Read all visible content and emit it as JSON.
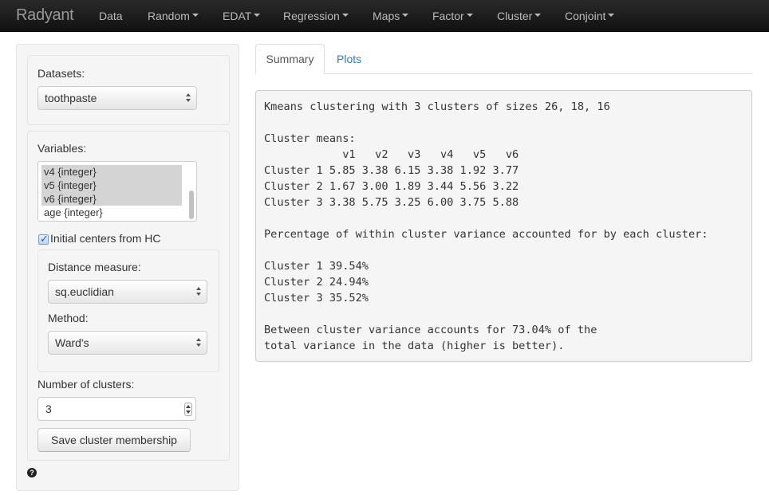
{
  "navbar": {
    "brand": "Radyant",
    "items": [
      {
        "label": "Data",
        "dropdown": false
      },
      {
        "label": "Random",
        "dropdown": true
      },
      {
        "label": "EDAT",
        "dropdown": true
      },
      {
        "label": "Regression",
        "dropdown": true
      },
      {
        "label": "Maps",
        "dropdown": true
      },
      {
        "label": "Factor",
        "dropdown": true
      },
      {
        "label": "Cluster",
        "dropdown": true
      },
      {
        "label": "Conjoint",
        "dropdown": true
      }
    ]
  },
  "sidebar": {
    "datasets_label": "Datasets:",
    "dataset_value": "toothpaste",
    "variables_label": "Variables:",
    "variables": [
      {
        "label": "v4 {integer}",
        "selected": true
      },
      {
        "label": "v5 {integer}",
        "selected": true
      },
      {
        "label": "v6 {integer}",
        "selected": true
      },
      {
        "label": "age {integer}",
        "selected": false
      }
    ],
    "hc_checkbox_label": "Initial centers from HC",
    "hc_checked": true,
    "distance_label": "Distance measure:",
    "distance_value": "sq.euclidian",
    "method_label": "Method:",
    "method_value": "Ward's",
    "nclusters_label": "Number of clusters:",
    "nclusters_value": "3",
    "save_button": "Save cluster membership",
    "help_icon": "?"
  },
  "tabs": [
    {
      "label": "Summary",
      "active": true
    },
    {
      "label": "Plots",
      "active": false
    }
  ],
  "output": {
    "text": "Kmeans clustering with 3 clusters of sizes 26, 18, 16\n\nCluster means:\n            v1   v2   v3   v4   v5   v6\nCluster 1 5.85 3.38 6.15 3.38 1.92 3.77\nCluster 2 1.67 3.00 1.89 3.44 5.56 3.22\nCluster 3 3.38 5.75 3.25 6.00 3.75 5.88\n\nPercentage of within cluster variance accounted for by each cluster:\n\nCluster 1 39.54%\nCluster 2 24.94%\nCluster 3 35.52%\n\nBetween cluster variance accounts for 73.04% of the\ntotal variance in the data (higher is better)."
  }
}
